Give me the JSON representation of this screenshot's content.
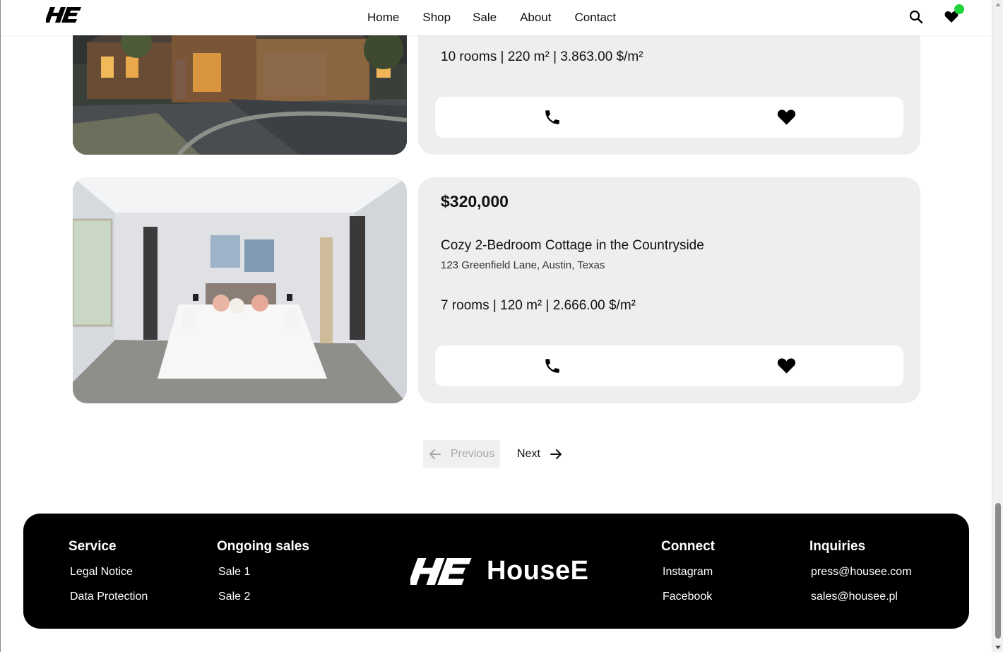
{
  "header": {
    "nav": [
      "Home",
      "Shop",
      "Sale",
      "About",
      "Contact"
    ],
    "notification_color": "#1ed43a"
  },
  "listings": [
    {
      "stats": "10 rooms | 220 m² | 3.863.00 $/m²"
    },
    {
      "price": "$320,000",
      "title": "Cozy 2-Bedroom Cottage in the Countryside",
      "address": "123 Greenfield Lane, Austin, Texas",
      "stats": "7 rooms | 120 m² | 2.666.00 $/m²"
    }
  ],
  "pagination": {
    "previous": "Previous",
    "next": "Next"
  },
  "footer": {
    "brand": "HouseE",
    "service": {
      "heading": "Service",
      "links": [
        "Legal Notice",
        "Data Protection"
      ]
    },
    "ongoing": {
      "heading": "Ongoing sales",
      "links": [
        "Sale 1",
        "Sale 2"
      ]
    },
    "connect": {
      "heading": "Connect",
      "links": [
        "Instagram",
        "Facebook"
      ]
    },
    "inquiries": {
      "heading": "Inquiries",
      "links": [
        "press@housee.com",
        "sales@housee.pl"
      ]
    }
  }
}
